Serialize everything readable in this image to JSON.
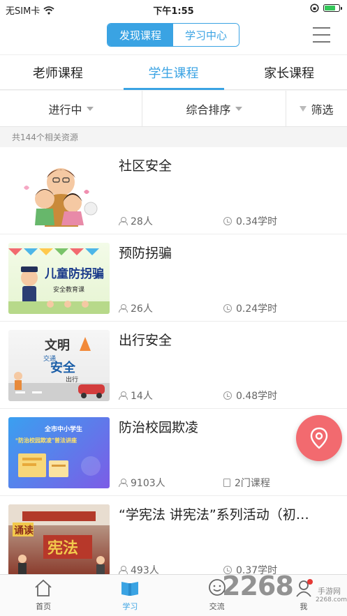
{
  "status_bar": {
    "carrier": "无SIM卡",
    "time": "下午1:55"
  },
  "top_nav": {
    "segments": [
      "发现课程",
      "学习中心"
    ],
    "active_segment": 0
  },
  "category_tabs": [
    "老师课程",
    "学生课程",
    "家长课程"
  ],
  "active_category": 1,
  "filters": {
    "status": "进行中",
    "sort": "综合排序",
    "filter": "筛选"
  },
  "result_count": "共144个相关资源",
  "courses": [
    {
      "title": "社区安全",
      "learners": "28人",
      "duration": "0.34学时"
    },
    {
      "title": "预防拐骗",
      "learners": "26人",
      "duration": "0.24学时",
      "thumb_text": [
        "儿童防拐骗",
        "安全教育课"
      ]
    },
    {
      "title": "出行安全",
      "learners": "14人",
      "duration": "0.48学时",
      "thumb_text": [
        "文明",
        "交通",
        "安全",
        "出行"
      ]
    },
    {
      "title": "防治校园欺凌",
      "learners": "9103人",
      "duration": "2门课程",
      "thumb_text": [
        "全市中小学生",
        "“防治校园欺凌”普法讲座"
      ]
    },
    {
      "title": "“学宪法  讲宪法”系列活动（初…",
      "learners": "493人",
      "duration": "0.37学时",
      "thumb_text": [
        "诵读",
        "宪法"
      ]
    }
  ],
  "tab_bar": [
    {
      "label": "首页"
    },
    {
      "label": "学习"
    },
    {
      "label": "交流"
    },
    {
      "label": "我"
    }
  ],
  "active_tab": 1,
  "watermark": {
    "brand": "2268",
    "sub": "手游网",
    "url": "2268.com"
  },
  "colors": {
    "accent": "#3aa3e3",
    "fab": "#f26a6f"
  },
  "icons": {
    "fab": "location-pin-icon",
    "learners": "person-icon",
    "duration": "clock-icon",
    "courses": "document-icon"
  }
}
